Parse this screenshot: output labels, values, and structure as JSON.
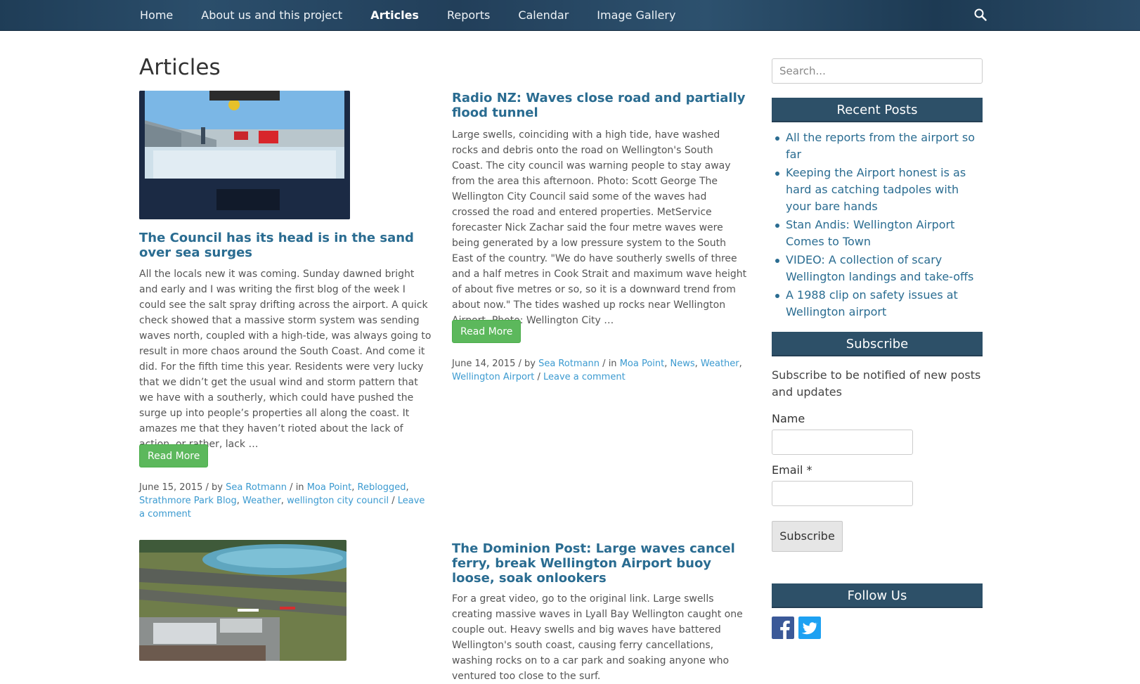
{
  "nav": {
    "items": [
      {
        "label": "Home",
        "active": false
      },
      {
        "label": "About us and this project",
        "active": false
      },
      {
        "label": "Articles",
        "active": true
      },
      {
        "label": "Reports",
        "active": false
      },
      {
        "label": "Calendar",
        "active": false
      },
      {
        "label": "Image Gallery",
        "active": false
      }
    ],
    "search_icon": "search-icon"
  },
  "page": {
    "title": "Articles"
  },
  "posts": [
    {
      "title": "The Council has its head is in the sand over sea surges",
      "excerpt": "All the locals new it was coming. Sunday dawned bright and early and I was writing the first blog of the week I could see the salt spray drifting across the airport. A quick check showed that a massive storm system was sending waves north, coupled with a high-tide, was always going to result in more chaos around the South Coast. And come it did. For the fifth time this year. Residents were very lucky that we didn’t get the usual wind and storm pattern that we have with a southerly, which could have pushed the surge up into people’s properties all along the coast. It amazes me that they haven’t rioted about the lack of action, or rather, lack …",
      "read_more": "Read More",
      "meta": {
        "date": "June 15, 2015",
        "by": " / by ",
        "author": "Sea Rotmann",
        "in": " / in ",
        "categories": [
          "Moa Point",
          "Reblogged",
          "Strathmore Park Blog",
          "Weather",
          "wellington city council"
        ],
        "sep": ", ",
        "comment_sep": " / ",
        "comment": "Leave a comment"
      }
    },
    {
      "title": "Radio NZ: Waves close road and partially flood tunnel",
      "excerpt": "Large swells, coinciding with a high tide, have washed rocks and debris onto the road on Wellington's South Coast. The city council was warning people to stay away from the area this afternoon. Photo: Scott George The Wellington City Council said some of the waves had crossed the road and entered properties. MetService forecaster Nick Zachar said the four metre waves were being generated by a low pressure system to the South East of the country. \"We do have southerly swells of three and a half metres in Cook Strait and maximum wave height of about five metres or so, so it is a downward trend from about now.\" The tides washed up rocks near Wellington Airport. Photo: Wellington City …",
      "read_more": "Read More",
      "meta": {
        "date": "June 14, 2015",
        "by": " / by ",
        "author": "Sea Rotmann",
        "in": " / in ",
        "categories": [
          "Moa Point",
          "News",
          "Weather",
          "Wellington Airport"
        ],
        "sep": ", ",
        "comment_sep": " / ",
        "comment": "Leave a comment"
      }
    },
    {
      "title": "The Dominion Post: Large waves cancel ferry, break Wellington Airport buoy loose, soak onlookers",
      "excerpt": "For a great video, go to the original link. Large swells creating massive waves in Lyall Bay Wellington caught one couple out. Heavy swells and big waves have battered Wellington's south coast, causing ferry cancellations, washing rocks on to a car park and soaking anyone who ventured too close to the surf."
    }
  ],
  "sidebar": {
    "search_placeholder": "Search...",
    "recent_title": "Recent Posts",
    "recent_posts": [
      "All the reports from the airport so far",
      "Keeping the Airport honest is as hard as catching tadpoles with your bare hands",
      "Stan Andis: Wellington Airport Comes to Town",
      "VIDEO: A collection of scary Wellington landings and take-offs",
      "A 1988 clip on safety issues at Wellington airport"
    ],
    "subscribe_title": "Subscribe",
    "subscribe_desc": "Subscribe to be notified of new posts and updates",
    "name_label": "Name",
    "email_label": "Email *",
    "subscribe_button": "Subscribe",
    "follow_title": "Follow Us",
    "social": [
      {
        "name": "facebook-icon",
        "color": "#3b5998"
      },
      {
        "name": "twitter-icon",
        "color": "#1da1f2"
      }
    ]
  }
}
